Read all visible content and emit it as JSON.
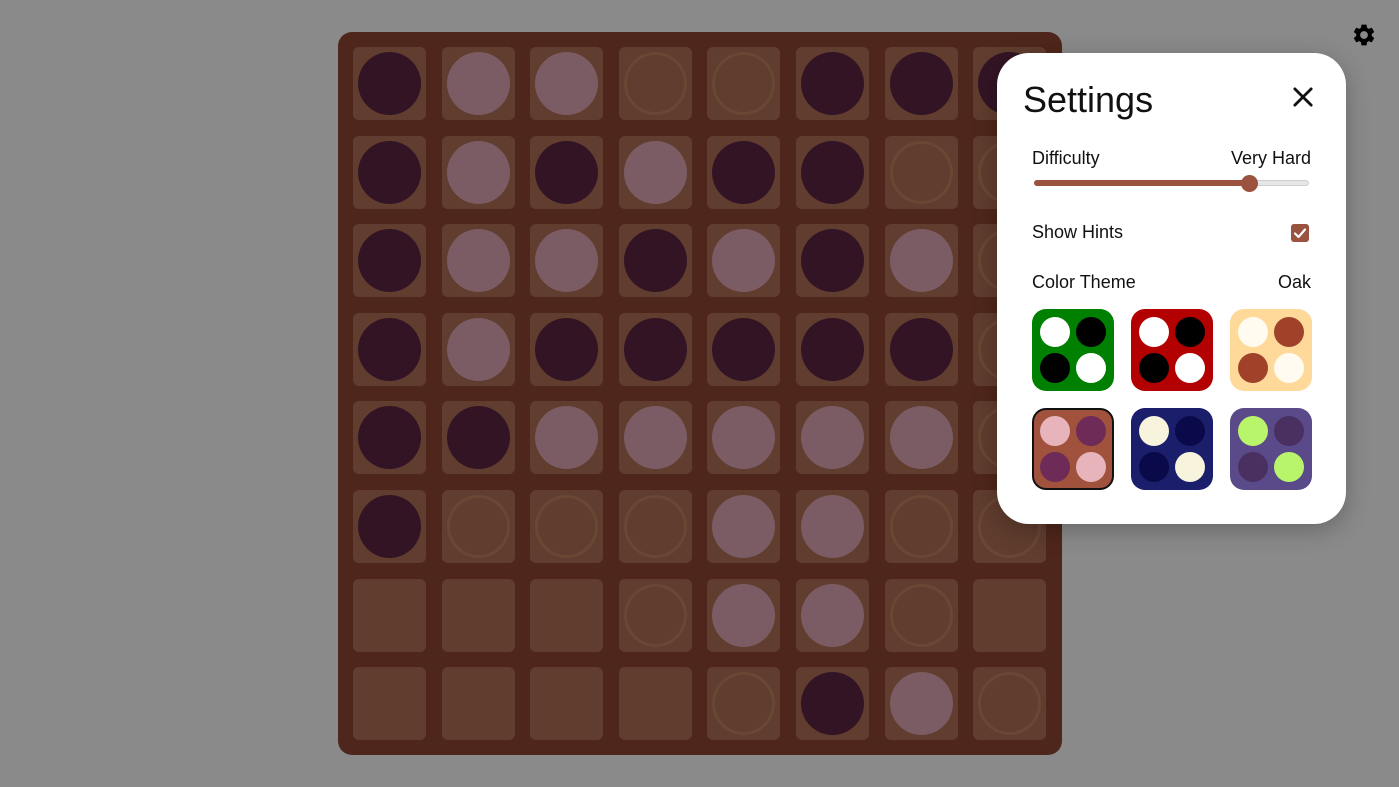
{
  "board": {
    "rows": [
      [
        "dark",
        "light",
        "light",
        "hint",
        "hint",
        "dark",
        "dark",
        "dark"
      ],
      [
        "dark",
        "light",
        "dark",
        "light",
        "dark",
        "dark",
        "hint",
        "hint"
      ],
      [
        "dark",
        "light",
        "light",
        "dark",
        "light",
        "dark",
        "light",
        "hint"
      ],
      [
        "dark",
        "light",
        "dark",
        "dark",
        "dark",
        "dark",
        "dark",
        "hint"
      ],
      [
        "dark",
        "dark",
        "light",
        "light",
        "light",
        "light",
        "light",
        "hint"
      ],
      [
        "dark",
        "hint",
        "hint",
        "hint",
        "light",
        "light",
        "hint",
        "hint"
      ],
      [
        "empty",
        "empty",
        "empty",
        "hint",
        "light",
        "light",
        "hint",
        "empty"
      ],
      [
        "empty",
        "empty",
        "empty",
        "empty",
        "hint",
        "dark",
        "light",
        "hint"
      ]
    ],
    "colors": {
      "frame": "#4f261b",
      "square": "#603d2e",
      "dark_disc": "#331425",
      "light_disc": "#7c5c64"
    }
  },
  "header": {
    "settings_icon": "gear-icon"
  },
  "settings": {
    "title": "Settings",
    "close_icon": "close-icon",
    "difficulty": {
      "label": "Difficulty",
      "value_label": "Very Hard",
      "level_fraction": 0.78
    },
    "show_hints": {
      "label": "Show Hints",
      "checked": true
    },
    "color_theme": {
      "label": "Color Theme",
      "value_label": "Oak",
      "themes": [
        {
          "name": "classic-green",
          "bg": "#008000",
          "a": "#ffffff",
          "b": "#000000",
          "selected": false
        },
        {
          "name": "red",
          "bg": "#b30000",
          "a": "#ffffff",
          "b": "#000000",
          "selected": false
        },
        {
          "name": "cream",
          "bg": "#ffd99a",
          "a": "#fffbf0",
          "b": "#a0412a",
          "selected": false
        },
        {
          "name": "oak",
          "bg": "#a0523d",
          "a": "#e8b4bc",
          "b": "#6e2b57",
          "selected": true
        },
        {
          "name": "navy",
          "bg": "#1b1f6b",
          "a": "#f7f3dc",
          "b": "#0a0a4a",
          "selected": false
        },
        {
          "name": "purple",
          "bg": "#5a4a8a",
          "a": "#b9f56b",
          "b": "#4a3060",
          "selected": false
        }
      ]
    },
    "accent_color": "#9b5340"
  }
}
